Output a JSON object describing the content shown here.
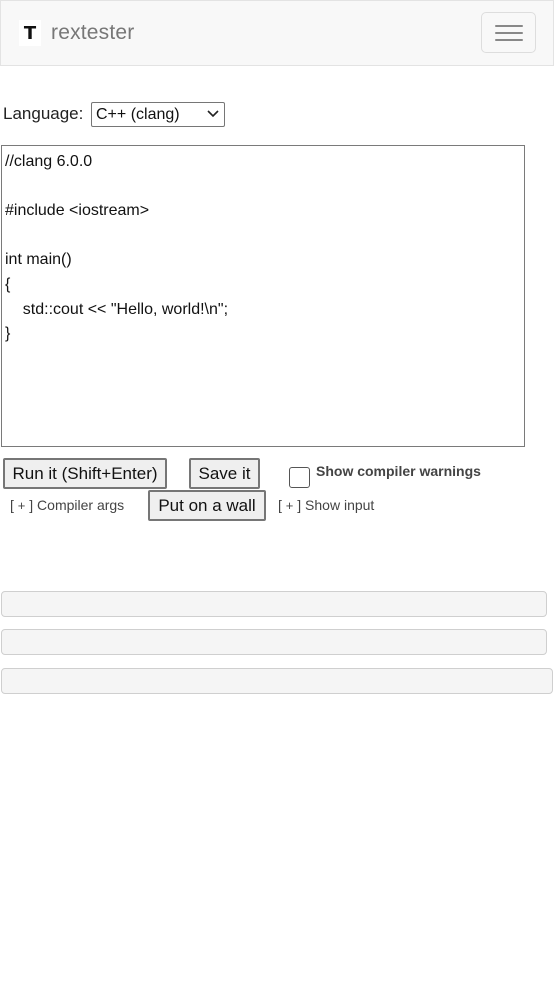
{
  "header": {
    "logo_glyph": "T",
    "brand_name": "rextester",
    "menu_icon": "hamburger-menu-icon"
  },
  "language": {
    "label": "Language:",
    "selected": "C++ (clang)"
  },
  "editor": {
    "lines": [
      "//clang 6.0.0",
      "",
      "#include <iostream>",
      "",
      "int main()",
      "{",
      "    std::cout << \"Hello, world!\\n\";",
      "}"
    ]
  },
  "actions": {
    "run_label": "Run it (Shift+Enter)",
    "save_label": "Save it",
    "wall_label": "Put on a wall",
    "warnings_label": "Show compiler warnings",
    "warnings_checked": false,
    "compiler_args": {
      "prefix": "[",
      "plus": "+",
      "suffix": "]",
      "label": "Compiler args"
    },
    "show_input": {
      "prefix": "[",
      "plus": "+",
      "suffix": "]",
      "label": "Show input"
    }
  },
  "colors": {
    "navbar_bg": "#f8f8f8",
    "brand_text": "#777777",
    "button_bg": "#efefef",
    "panel_bg": "#f5f5f5"
  }
}
